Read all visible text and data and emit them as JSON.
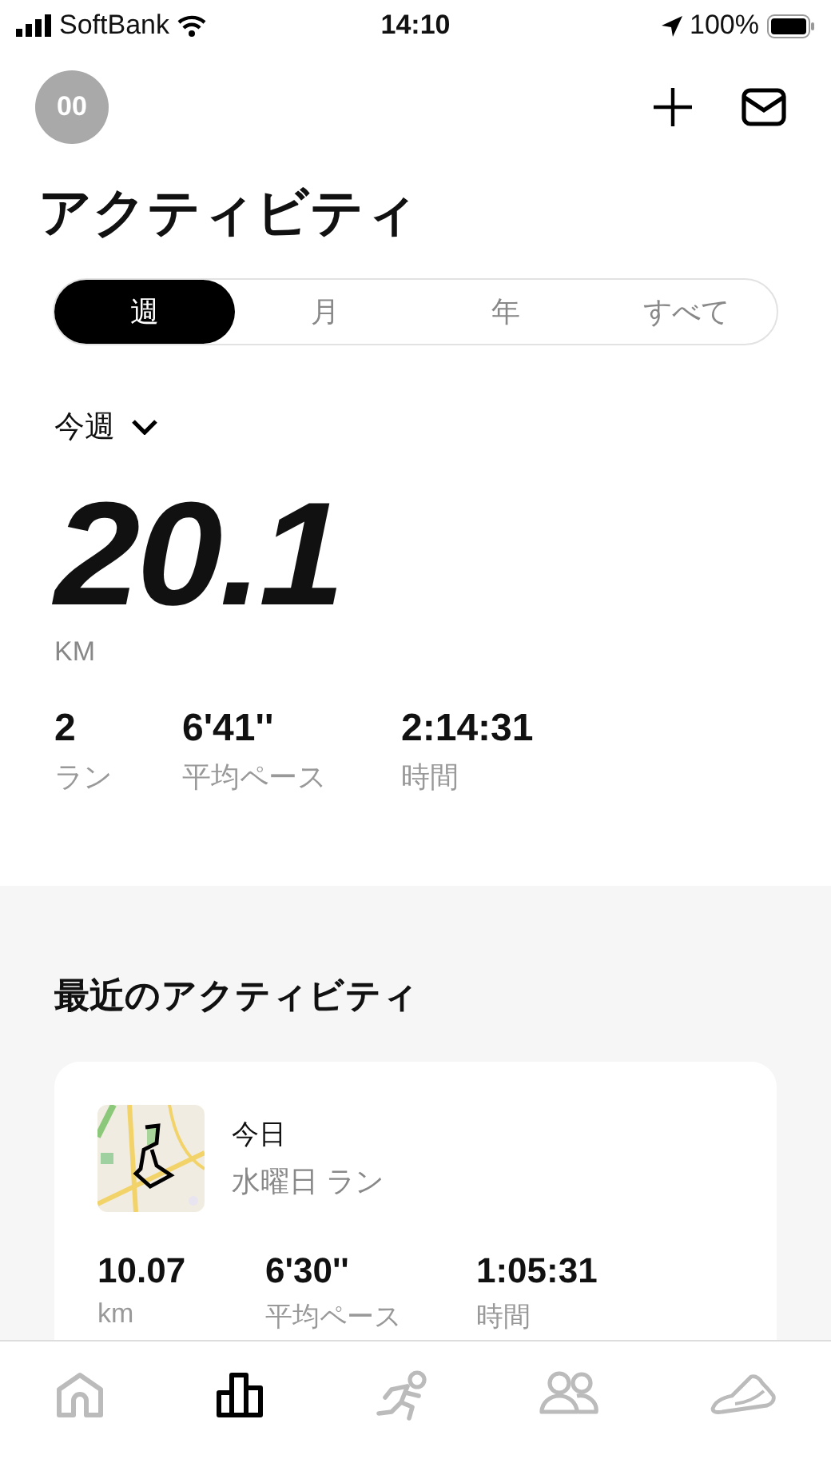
{
  "status_bar": {
    "carrier": "SoftBank",
    "time": "14:10",
    "battery": "100%"
  },
  "header": {
    "avatar": "00"
  },
  "title": "アクティビティ",
  "periods": [
    {
      "label": "週",
      "selected": true
    },
    {
      "label": "月",
      "selected": false
    },
    {
      "label": "年",
      "selected": false
    },
    {
      "label": "すべて",
      "selected": false
    }
  ],
  "range": "今週",
  "total": {
    "value": "20.1",
    "unit": "KM"
  },
  "stats": [
    {
      "value": "2",
      "label": "ラン"
    },
    {
      "value": "6'41''",
      "label": "平均ペース"
    },
    {
      "value": "2:14:31",
      "label": "時間"
    }
  ],
  "recent": {
    "heading": "最近のアクティビティ",
    "activities": [
      {
        "kind": "picture",
        "date": "今日",
        "name": "水曜日 ラン",
        "stats": [
          {
            "value": "10.07",
            "label": "km"
          },
          {
            "value": "6'30''",
            "label": "平均ペース"
          },
          {
            "value": "1:05:31",
            "label": "時間"
          }
        ]
      }
    ]
  },
  "tab_bar": [
    {
      "kind": "home",
      "selected": false
    },
    {
      "kind": "activity",
      "selected": true
    },
    {
      "kind": "run",
      "selected": false
    },
    {
      "kind": "club",
      "selected": false
    },
    {
      "kind": "shoe",
      "selected": false
    }
  ]
}
